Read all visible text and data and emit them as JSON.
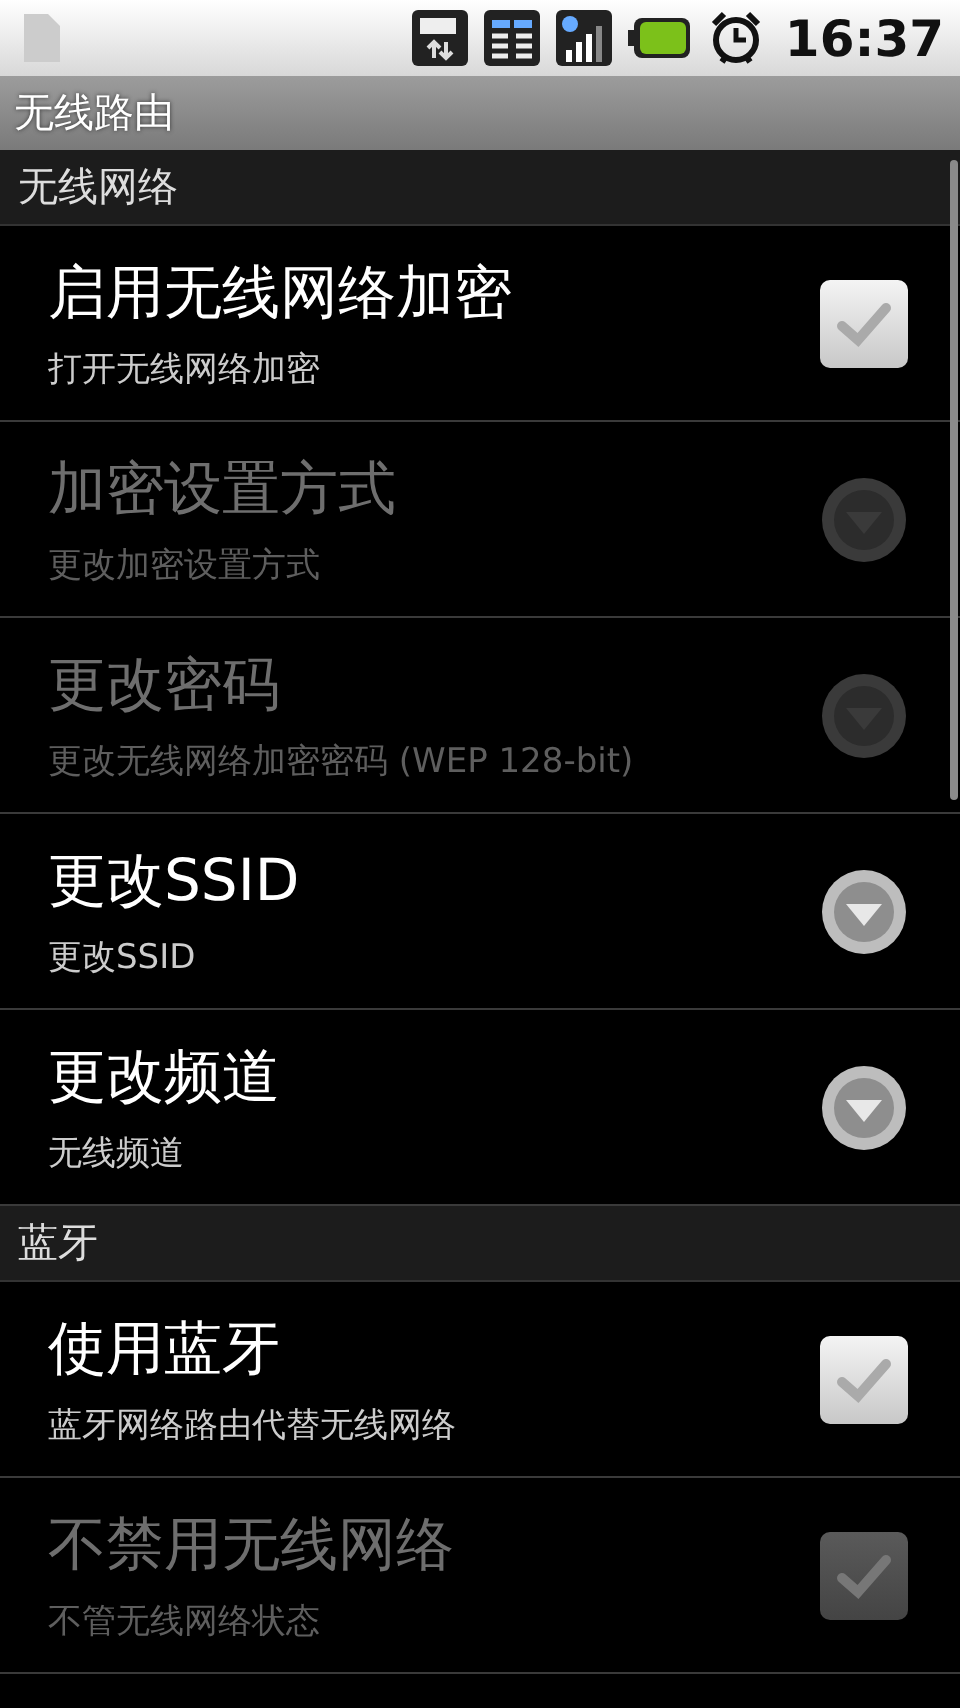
{
  "status_bar": {
    "time": "16:37"
  },
  "title_bar": {
    "title": "无线路由"
  },
  "sections": [
    {
      "header": "无线网络",
      "items": [
        {
          "kind": "checkbox",
          "title": "启用无线网络加密",
          "summary": "打开无线网络加密",
          "disabled": false,
          "checked": true
        },
        {
          "kind": "dropdown",
          "title": "加密设置方式",
          "summary": "更改加密设置方式",
          "disabled": true
        },
        {
          "kind": "dropdown",
          "title": "更改密码",
          "summary": "更改无线网络加密密码 (WEP 128-bit)",
          "disabled": true
        },
        {
          "kind": "dropdown",
          "title": "更改SSID",
          "summary": "更改SSID",
          "disabled": false
        },
        {
          "kind": "dropdown",
          "title": "更改频道",
          "summary": "无线频道",
          "disabled": false
        }
      ]
    },
    {
      "header": "蓝牙",
      "items": [
        {
          "kind": "checkbox",
          "title": "使用蓝牙",
          "summary": "蓝牙网络路由代替无线网络",
          "disabled": false,
          "checked": true
        },
        {
          "kind": "checkbox",
          "title": "不禁用无线网络",
          "summary": "不管无线网络状态",
          "disabled": true,
          "checked": true
        }
      ]
    }
  ]
}
